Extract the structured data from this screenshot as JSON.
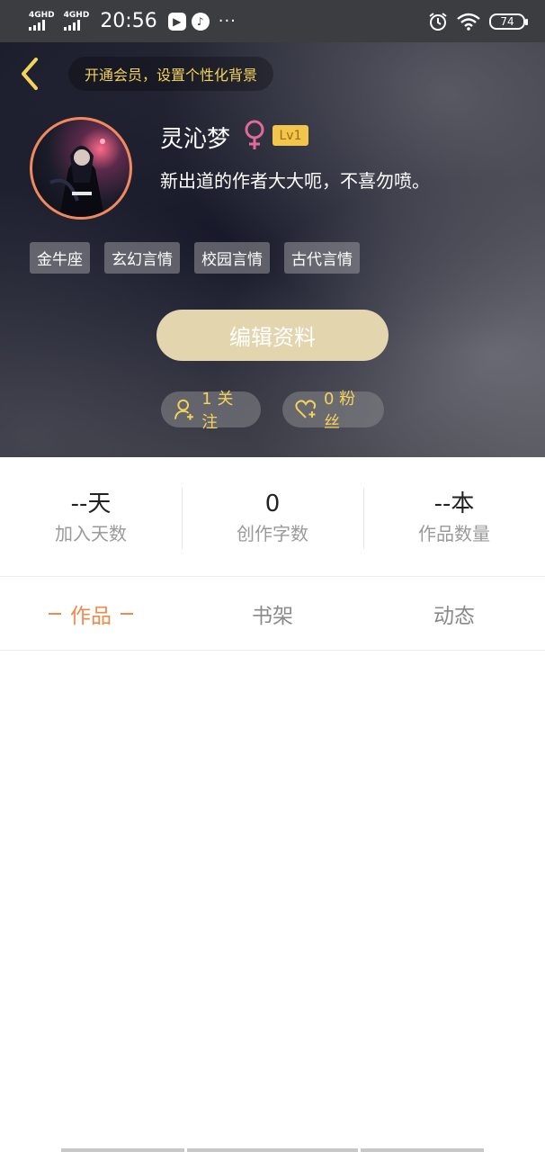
{
  "status_bar": {
    "network_1": "4GHD",
    "network_2": "4GHD",
    "time": "20:56",
    "dots": "···",
    "battery": "74"
  },
  "header": {
    "vip_banner": "开通会员，设置个性化背景",
    "username": "灵沁梦",
    "level": "Lv1",
    "bio": "新出道的作者大大呃，不喜勿喷。",
    "tags": [
      "金牛座",
      "玄幻言情",
      "校园言情",
      "古代言情"
    ],
    "edit_button": "编辑资料",
    "follow_label": "1 关注",
    "fans_label": "0 粉丝"
  },
  "stats": [
    {
      "value": "--天",
      "label": "加入天数"
    },
    {
      "value": "0",
      "label": "创作字数"
    },
    {
      "value": "--本",
      "label": "作品数量"
    }
  ],
  "tabs": [
    {
      "label": "作品",
      "active": true
    },
    {
      "label": "书架",
      "active": false
    },
    {
      "label": "动态",
      "active": false
    }
  ],
  "colors": {
    "accent_gold": "#f3d35a",
    "tab_active": "#f08a4b",
    "edit_button_bg": "#e3d5ae",
    "gender_female": "#e06a9a"
  }
}
